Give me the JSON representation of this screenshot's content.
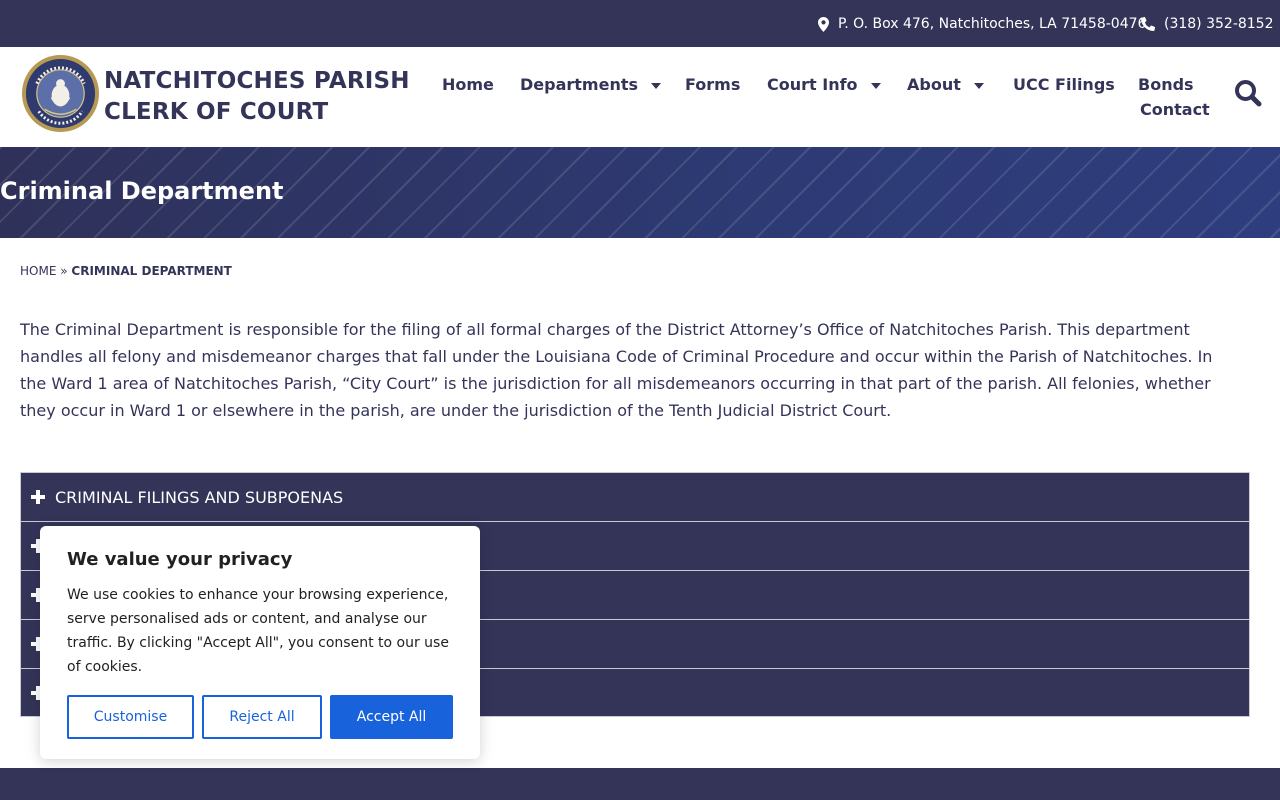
{
  "topbar": {
    "address": "P. O. Box 476, Natchitoches, LA 71458-0476",
    "phone": "(318) 352-8152"
  },
  "header": {
    "title_line1": "NATCHITOCHES PARISH",
    "title_line2": "CLERK OF COURT",
    "seal_text": "STATE OF LOUISIANA"
  },
  "nav": {
    "home": "Home",
    "departments": "Departments",
    "forms": "Forms",
    "court_info": "Court Info",
    "about": "About",
    "ucc": "UCC Filings",
    "bonds": "Bonds",
    "contact": "Contact"
  },
  "hero": {
    "title": "Criminal Department"
  },
  "breadcrumb": {
    "home": "HOME",
    "separator": "»",
    "current": "CRIMINAL DEPARTMENT"
  },
  "intro": "The Criminal Department is responsible for the filing of all formal charges of the District Attorney’s Office of Natchitoches Parish. This department handles all felony and misdemeanor charges that fall under the Louisiana Code of Criminal Procedure and occur within the Parish of Natchitoches. In the Ward 1 area of Natchitoches Parish, “City Court” is the jurisdiction for all misdemeanors occurring in that part of the parish. All felonies, whether they occur in Ward 1 or elsewhere in the parish, are under the jurisdiction of the Tenth Judicial District Court.",
  "accordion": {
    "item1": "CRIMINAL FILINGS AND SUBPOENAS"
  },
  "cookie": {
    "title": "We value your privacy",
    "body": "We use cookies to enhance your browsing experience, serve personalised ads or content, and analyse our traffic. By clicking \"Accept All\", you consent to our use of cookies.",
    "customise": "Customise",
    "reject": "Reject All",
    "accept": "Accept All"
  },
  "colors": {
    "navy": "#343459",
    "accent_blue": "#1863dc"
  },
  "icons": [
    "map-marker-icon",
    "phone-icon",
    "search-icon",
    "caret-down-icon",
    "plus-icon"
  ]
}
